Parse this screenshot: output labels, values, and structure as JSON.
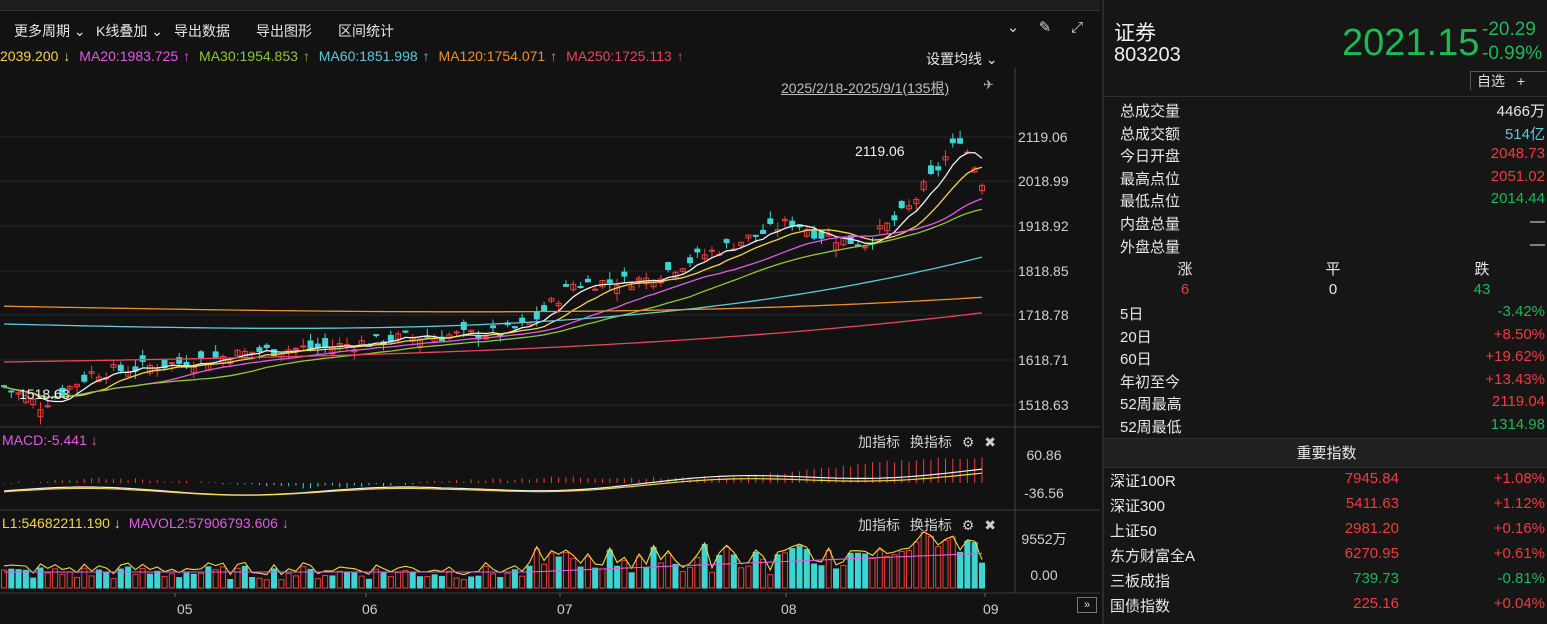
{
  "toolbar": {
    "more_period": "更多周期",
    "kline_overlay": "K线叠加",
    "export_data": "导出数据",
    "export_chart": "导出图形",
    "range_stats": "区间统计",
    "set_ma": "设置均线"
  },
  "ma_values": {
    "ma10": "2039.200",
    "ma20": "MA20:1983.725",
    "ma30": "MA30:1954.853",
    "ma60": "MA60:1851.998",
    "ma120": "MA120:1754.071",
    "ma250": "MA250:1725.113",
    "ma10_color": "#f5d547",
    "ma20_color": "#e05ce0",
    "ma30_color": "#8fc63a",
    "ma60_color": "#5fc8d8",
    "ma120_color": "#f0902a",
    "ma250_color": "#e8475a"
  },
  "chart_header": {
    "date_range": "2025/2/18-2025/9/1(135根)",
    "peak_label": "2119.06",
    "low_label": "1518.63"
  },
  "price_axis": [
    "2119.06",
    "2018.99",
    "1918.92",
    "1818.85",
    "1718.78",
    "1618.71",
    "1518.63"
  ],
  "x_axis": [
    "05",
    "06",
    "07",
    "08",
    "09"
  ],
  "macd": {
    "title": "MACD:-5.441",
    "axis_top": "60.86",
    "axis_bottom": "-36.56",
    "add_indicator": "加指标",
    "switch_indicator": "换指标"
  },
  "volume": {
    "title": "L1:54682211.190",
    "mavol2": "MAVOL2:57906793.606",
    "axis_top": "9552万",
    "axis_bottom": "0.00",
    "add_indicator": "加指标",
    "switch_indicator": "换指标"
  },
  "quote": {
    "name": "证券",
    "code": "803203",
    "price": "2021.15",
    "change": "-20.29",
    "change_pct": "-0.99%",
    "watchlist": "自选",
    "rows": [
      {
        "label": "总成交量",
        "value": "4466万",
        "color": "#e8e8e8"
      },
      {
        "label": "总成交额",
        "value": "514亿",
        "color": "#5fc8d8"
      },
      {
        "label": "今日开盘",
        "value": "2048.73",
        "color": "#f03c3c"
      },
      {
        "label": "最高点位",
        "value": "2051.02",
        "color": "#f03c3c"
      },
      {
        "label": "最低点位",
        "value": "2014.44",
        "color": "#1db954"
      },
      {
        "label": "内盘总量",
        "value": "—",
        "color": "#e8e8e8"
      },
      {
        "label": "外盘总量",
        "value": "—",
        "color": "#e8e8e8"
      }
    ],
    "counts": {
      "up_label": "涨",
      "flat_label": "平",
      "down_label": "跌",
      "up": "6",
      "flat": "0",
      "down": "43"
    },
    "periods": [
      {
        "label": "5日",
        "value": "-3.42%",
        "color": "#1db954"
      },
      {
        "label": "20日",
        "value": "+8.50%",
        "color": "#f03c3c"
      },
      {
        "label": "60日",
        "value": "+19.62%",
        "color": "#f03c3c"
      },
      {
        "label": "年初至今",
        "value": "+13.43%",
        "color": "#f03c3c"
      },
      {
        "label": "52周最高",
        "value": "2119.04",
        "color": "#f03c3c"
      },
      {
        "label": "52周最低",
        "value": "1314.98",
        "color": "#1db954"
      }
    ]
  },
  "indices": {
    "title": "重要指数",
    "items": [
      {
        "name": "深证100R",
        "price": "7945.84",
        "change": "+1.08%",
        "color": "#f03c3c"
      },
      {
        "name": "深证300",
        "price": "5411.63",
        "change": "+1.12%",
        "color": "#f03c3c"
      },
      {
        "name": "上证50",
        "price": "2981.20",
        "change": "+0.16%",
        "color": "#f03c3c"
      },
      {
        "name": "东方财富全A",
        "price": "6270.95",
        "change": "+0.61%",
        "color": "#f03c3c"
      },
      {
        "name": "三板成指",
        "price": "739.73",
        "change": "-0.81%",
        "color": "#1db954"
      },
      {
        "name": "国债指数",
        "price": "225.16",
        "change": "+0.04%",
        "color": "#f03c3c"
      }
    ]
  }
}
